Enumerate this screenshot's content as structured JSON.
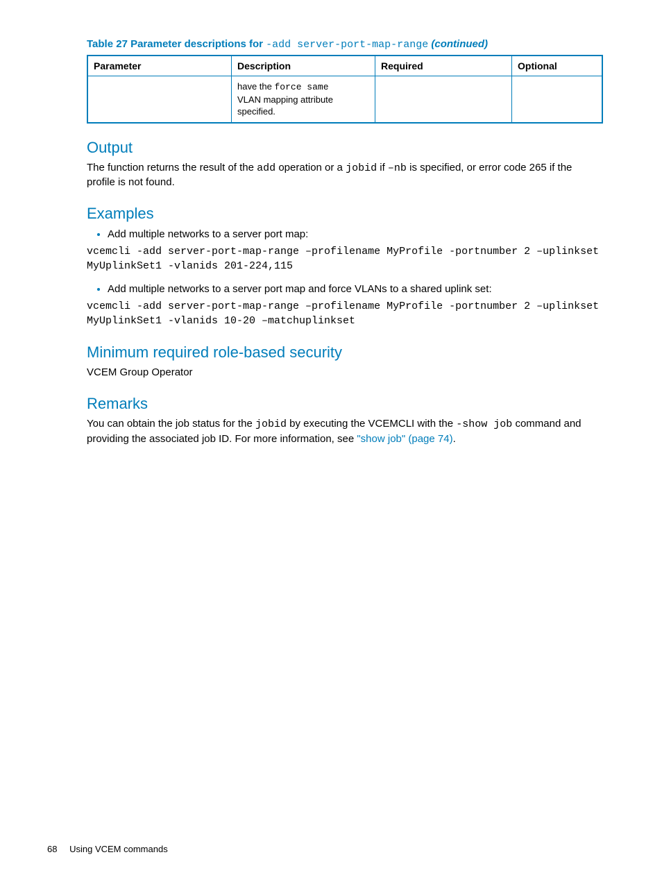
{
  "table": {
    "caption_prefix": "Table 27 Parameter descriptions for ",
    "caption_mono": "-add server-port-map-range",
    "caption_suffix": " (continued)",
    "headers": [
      "Parameter",
      "Description",
      "Required",
      "Optional"
    ],
    "row": {
      "param": "",
      "desc_pre": "have the ",
      "desc_mono": "force same",
      "desc_post1": "VLAN mapping attribute",
      "desc_post2": "specified.",
      "required": "",
      "optional": ""
    }
  },
  "output": {
    "heading": "Output",
    "p1_pre": "The function returns the result of the ",
    "p1_m1": "add",
    "p1_mid1": " operation or a ",
    "p1_m2": "jobid",
    "p1_mid2": " if ",
    "p1_m3": "–nb",
    "p1_post": " is specified, or error code 265 if the profile is not found."
  },
  "examples": {
    "heading": "Examples",
    "item1_text": "Add multiple networks to a server port map:",
    "item1_code": "vcemcli -add server-port-map-range –profilename MyProfile -portnumber 2 –uplinkset MyUplinkSet1 -vlanids 201-224,115",
    "item2_text": "Add multiple networks to a server port map and force VLANs to a shared uplink set:",
    "item2_code": "vcemcli -add server-port-map-range –profilename MyProfile -portnumber 2 –uplinkset MyUplinkSet1 -vlanids 10-20 –matchuplinkset"
  },
  "minrole": {
    "heading": "Minimum required role-based security",
    "text": "VCEM Group Operator"
  },
  "remarks": {
    "heading": "Remarks",
    "p_pre": "You can obtain the job status for the ",
    "p_m1": "jobid",
    "p_mid1": " by executing the VCEMCLI with the ",
    "p_m2": "-show job",
    "p_mid2": " command and providing the associated job ID. For more information, see ",
    "link": "\"show job\" (page 74)",
    "p_post": "."
  },
  "footer": {
    "page": "68",
    "title": "Using VCEM commands"
  }
}
